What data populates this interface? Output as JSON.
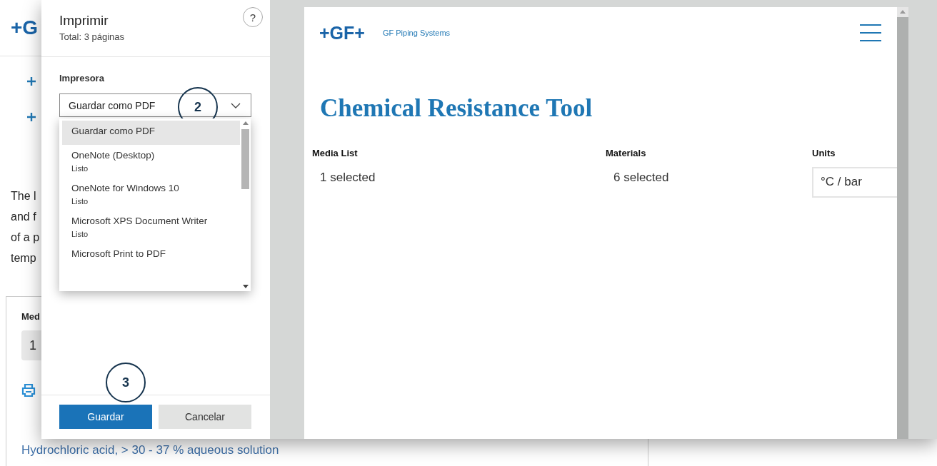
{
  "background_page": {
    "logo": "+G",
    "paragraph_lines": [
      "The l",
      "and f",
      "of a p",
      "temp"
    ],
    "media_label": "Med",
    "media_value": "1",
    "link": "Hydrochloric acid, > 30 - 37 % aqueous solution"
  },
  "print_dialog": {
    "title": "Imprimir",
    "subtitle": "Total: 3 páginas",
    "help": "?",
    "printer_label": "Impresora",
    "printer_select": {
      "value": "Guardar como PDF",
      "expanded": true
    },
    "printer_options": [
      {
        "name": "Guardar como PDF",
        "selected": true
      },
      {
        "name": "OneNote (Desktop)",
        "status": "Listo",
        "selected": false
      },
      {
        "name": "OneNote for Windows 10",
        "status": "Listo",
        "selected": false
      },
      {
        "name": "Microsoft XPS Document Writer",
        "status": "Listo",
        "selected": false
      },
      {
        "name": "Microsoft Print to PDF",
        "selected": false
      }
    ],
    "buttons": [
      {
        "label": "Guardar",
        "kind": "primary"
      },
      {
        "label": "Cancelar",
        "kind": "secondary"
      }
    ]
  },
  "step_markers": [
    "2",
    "3"
  ],
  "preview": {
    "logo": "+GF+",
    "brand": "GF Piping Systems",
    "title": "Chemical Resistance Tool",
    "filters": [
      {
        "label": "Media List",
        "value": "1 selected",
        "kind": "text"
      },
      {
        "label": "Materials",
        "value": "6 selected",
        "kind": "text"
      },
      {
        "label": "Units",
        "value": "°C / bar",
        "kind": "field"
      }
    ]
  }
}
